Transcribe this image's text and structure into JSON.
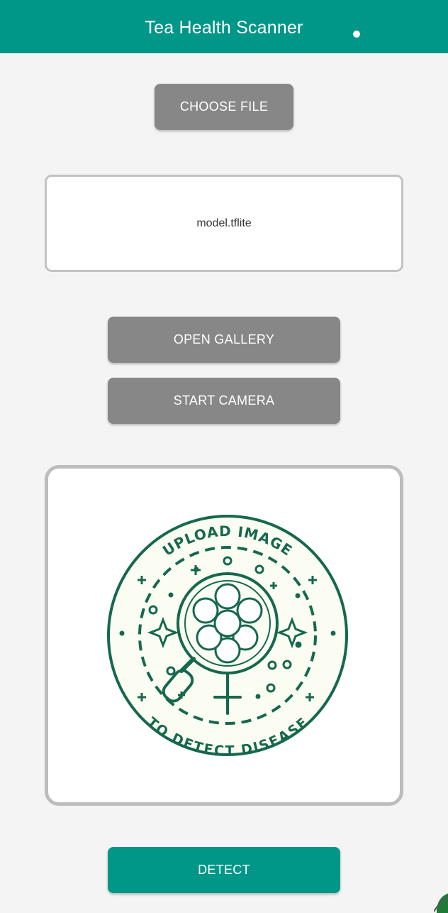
{
  "app_bar": {
    "title": "Tea Health Scanner",
    "color": "#009688"
  },
  "buttons": {
    "choose_file": "CHOOSE FILE",
    "open_gallery": "OPEN GALLERY",
    "start_camera": "START CAMERA",
    "detect": "DETECT"
  },
  "file_box": {
    "file_name": "model.tflite"
  },
  "placeholder_badge": {
    "top_text": "UPLOAD IMAGE",
    "bottom_text": "TO DETECT DISEASE",
    "icon": "magnifier-flower-icon",
    "color": "#16684d",
    "background": "#fbfdf3"
  },
  "colors": {
    "accent": "#009688",
    "button_gray": "#878787",
    "background": "#f4f4f4"
  }
}
